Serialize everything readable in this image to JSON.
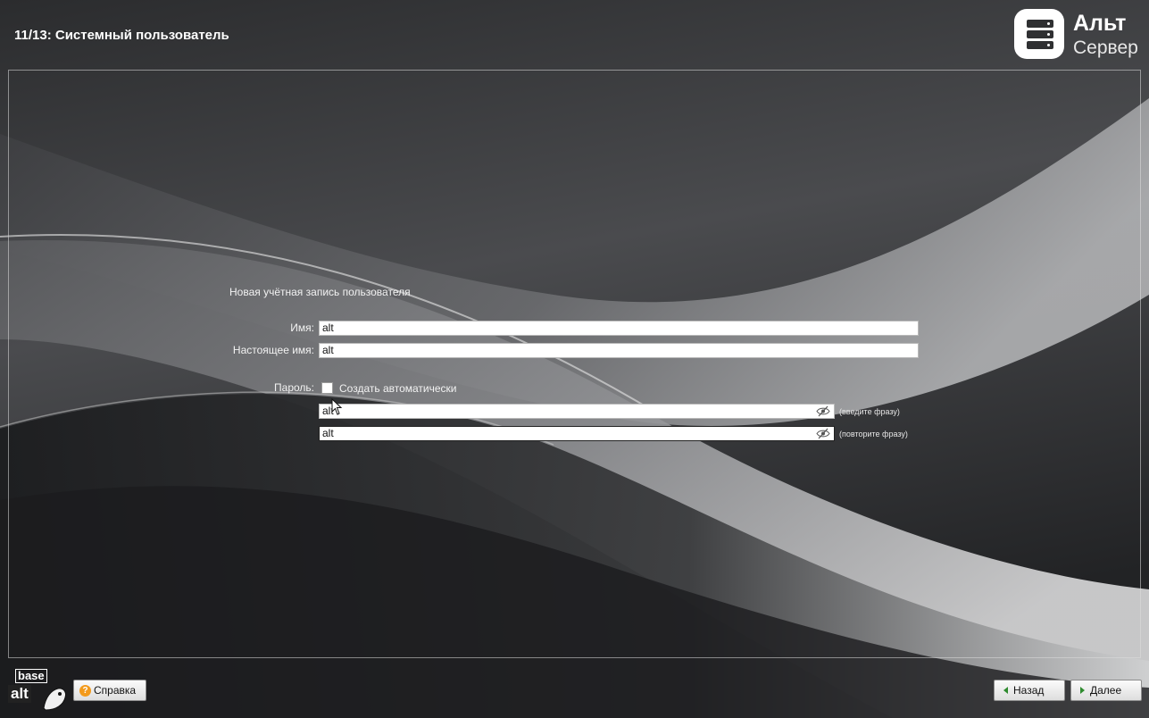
{
  "header": {
    "step_title": "11/13: Системный пользователь",
    "logo_line1": "Альт",
    "logo_line2": "Сервер"
  },
  "form": {
    "section_title": "Новая учётная запись пользователя",
    "name_label": "Имя:",
    "name_value": "alt",
    "realname_label": "Настоящее имя:",
    "realname_value": "alt",
    "password_label": "Пароль:",
    "auto_generate_label": "Создать автоматически",
    "auto_generate_checked": false,
    "password_value": "alt",
    "password_hint": "(введите фразу)",
    "password_confirm_value": "alt",
    "password_confirm_hint": "(повторите фразу)"
  },
  "footer": {
    "help_label": "Справка",
    "back_label": "Назад",
    "next_label": "Далее",
    "brand_top": "base",
    "brand_bottom": "alt"
  },
  "colors": {
    "help_icon": "#f39a1c",
    "nav_arrow": "#2e8b2e"
  },
  "icons": {
    "logo": "server-stack-icon",
    "password_toggle": "eye-slash-icon",
    "help": "question-mark-icon",
    "back": "chevron-left-icon",
    "next": "chevron-right-icon"
  }
}
